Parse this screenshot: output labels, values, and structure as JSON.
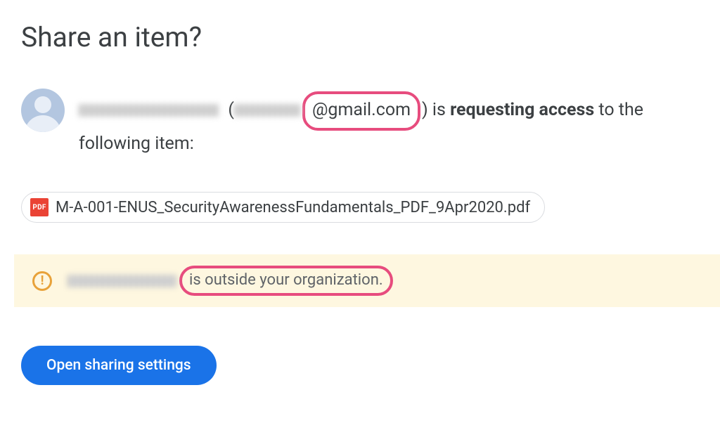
{
  "dialog": {
    "title": "Share an item?"
  },
  "requester": {
    "redacted_name": true,
    "email_domain": "@gmail.com",
    "action_text_prefix": " is ",
    "action_text_bold": "requesting access",
    "action_text_suffix": " to the following item:"
  },
  "file": {
    "name": "M-A-001-ENUS_SecurityAwarenessFundamentals_PDF_9Apr2020.pdf",
    "type": "PDF"
  },
  "warning": {
    "message": "is outside your organization."
  },
  "actions": {
    "open_settings": "Open sharing settings"
  },
  "annotations": {
    "highlights": [
      "email-domain",
      "outside-organization-message"
    ]
  }
}
